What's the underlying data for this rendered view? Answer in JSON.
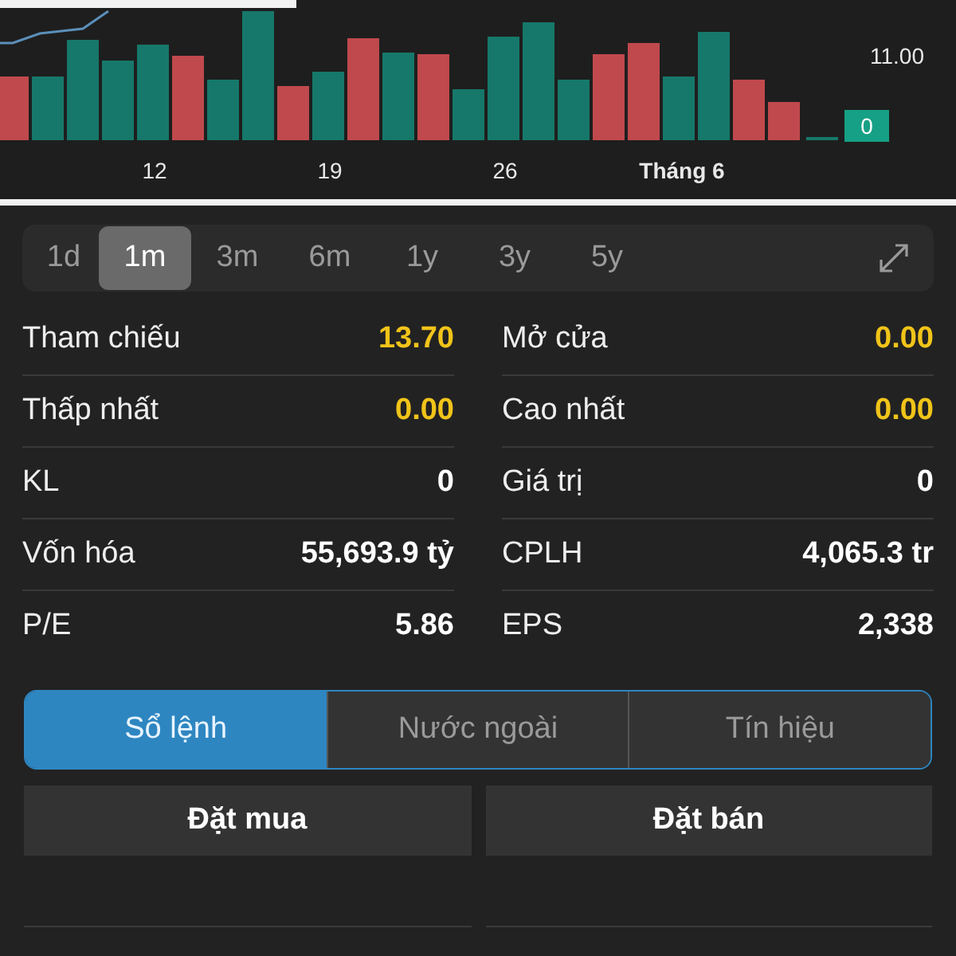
{
  "chart": {
    "price_label": "11.00",
    "volume_badge": "0",
    "x_labels": [
      {
        "label": "12",
        "kind": "day"
      },
      {
        "label": "19",
        "kind": "day"
      },
      {
        "label": "26",
        "kind": "day"
      },
      {
        "label": "Tháng 6",
        "kind": "month"
      }
    ]
  },
  "periods": [
    {
      "label": "1d",
      "selected": false
    },
    {
      "label": "1m",
      "selected": true
    },
    {
      "label": "3m",
      "selected": false
    },
    {
      "label": "6m",
      "selected": false
    },
    {
      "label": "1y",
      "selected": false
    },
    {
      "label": "3y",
      "selected": false
    },
    {
      "label": "5y",
      "selected": false
    }
  ],
  "stats": [
    {
      "label": "Tham chiếu",
      "value": "13.70",
      "kind": "price"
    },
    {
      "label": "Mở cửa",
      "value": "0.00",
      "kind": "price"
    },
    {
      "label": "Thấp nhất",
      "value": "0.00",
      "kind": "price"
    },
    {
      "label": "Cao nhất",
      "value": "0.00",
      "kind": "price"
    },
    {
      "label": "KL",
      "value": "0",
      "kind": "plain"
    },
    {
      "label": "Giá trị",
      "value": "0",
      "kind": "plain"
    },
    {
      "label": "Vốn hóa",
      "value": "55,693.9 tỷ",
      "kind": "plain"
    },
    {
      "label": "CPLH",
      "value": "4,065.3 tr",
      "kind": "plain"
    },
    {
      "label": "P/E",
      "value": "5.86",
      "kind": "plain"
    },
    {
      "label": "EPS",
      "value": "2,338",
      "kind": "plain"
    }
  ],
  "segments": [
    {
      "label": "Sổ lệnh",
      "selected": true
    },
    {
      "label": "Nước ngoài",
      "selected": false
    },
    {
      "label": "Tín hiệu",
      "selected": false
    }
  ],
  "buttons": [
    "Đặt mua",
    "Đặt bán"
  ]
}
